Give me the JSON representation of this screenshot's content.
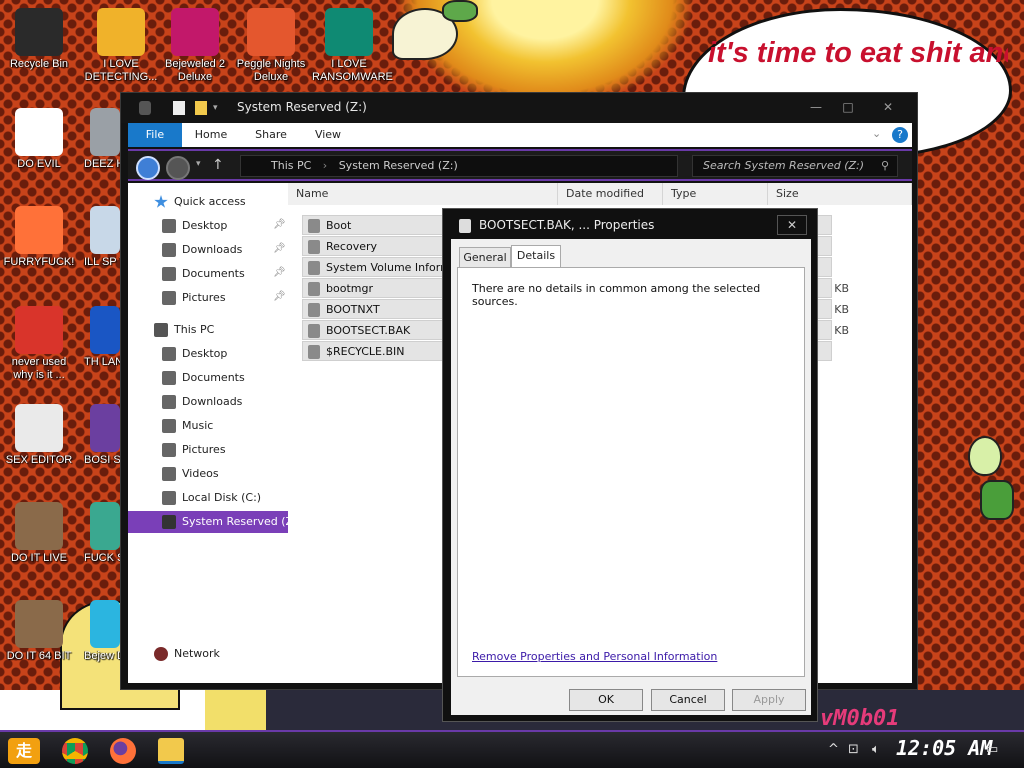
{
  "wallpaper": {
    "bubble_text": "it's time to eat shit and die and chew",
    "sign_text": "vM0b01"
  },
  "desktop_icons": [
    {
      "label": "Recycle Bin",
      "icon": "recycle-bin-icon",
      "color": "#2a2a2a"
    },
    {
      "label": "I LOVE DETECTING...",
      "icon": "detect-it-easy-icon",
      "color": "#f0b22a"
    },
    {
      "label": "Bejeweled 2 Deluxe",
      "icon": "bejeweled-icon",
      "color": "#c2186a"
    },
    {
      "label": "Peggle Nights Deluxe",
      "icon": "peggle-icon",
      "color": "#e4572e"
    },
    {
      "label": "I LOVE RANSOMWARE",
      "icon": "publisher-icon",
      "color": "#0f8a73"
    },
    {
      "label": "DO EVIL",
      "icon": "chrome-icon",
      "color": "#ffffff"
    },
    {
      "label": "DEEZ HAH G",
      "icon": "computer-icon",
      "color": "#9aa0a6"
    },
    {
      "label": "FURRYFUCK!",
      "icon": "firefox-icon",
      "color": "#ff7139"
    },
    {
      "label": "ILL SP YO",
      "icon": "spray-icon",
      "color": "#c8d8e8"
    },
    {
      "label": "never used why is it ...",
      "icon": "devcpp-icon",
      "color": "#d9342b"
    },
    {
      "label": "TH LANGUA",
      "icon": "go-icon",
      "color": "#1a56c4"
    },
    {
      "label": "SEX EDITOR",
      "icon": "hxd-icon",
      "color": "#eaeaea"
    },
    {
      "label": "BOSI SIMUL",
      "icon": "bonzi-icon",
      "color": "#6b3fa0"
    },
    {
      "label": "DO IT LIVE",
      "icon": "portrait-icon",
      "color": "#8a6a4a"
    },
    {
      "label": "FUCK S ELV",
      "icon": "game-icon",
      "color": "#3aa890"
    },
    {
      "label": "DO IT 64 BIT",
      "icon": "portrait-64-icon",
      "color": "#8a6a4a"
    },
    {
      "label": "Bejew Del",
      "icon": "gem-icon",
      "color": "#2bb5e0"
    }
  ],
  "explorer": {
    "title": "System Reserved (Z:)",
    "ribbon_tabs": [
      "File",
      "Home",
      "Share",
      "View"
    ],
    "address": {
      "crumbs": [
        "This PC",
        "System Reserved (Z:)"
      ]
    },
    "search_placeholder": "Search System Reserved (Z:)",
    "nav": {
      "quick_access": "Quick access",
      "quick_items": [
        "Desktop",
        "Downloads",
        "Documents",
        "Pictures"
      ],
      "this_pc": "This PC",
      "pc_items": [
        "Desktop",
        "Documents",
        "Downloads",
        "Music",
        "Pictures",
        "Videos",
        "Local Disk (C:)",
        "System Reserved (Z:)"
      ],
      "network": "Network"
    },
    "columns": [
      "Name",
      "Date modified",
      "Type",
      "Size"
    ],
    "files": [
      {
        "name": "Boot",
        "size": ""
      },
      {
        "name": "Recovery",
        "size": ""
      },
      {
        "name": "System Volume Informatio",
        "size": ""
      },
      {
        "name": "bootmgr",
        "size": "KB"
      },
      {
        "name": "BOOTNXT",
        "size": "KB"
      },
      {
        "name": "BOOTSECT.BAK",
        "size": "KB"
      },
      {
        "name": "$RECYCLE.BIN",
        "size": ""
      }
    ]
  },
  "properties": {
    "title": "BOOTSECT.BAK, ... Properties",
    "tabs": [
      "General",
      "Details"
    ],
    "active_tab": "Details",
    "message": "There are no details in common among the selected sources.",
    "link": "Remove Properties and Personal Information",
    "buttons": {
      "ok": "OK",
      "cancel": "Cancel",
      "apply": "Apply"
    }
  },
  "taskbar": {
    "clock": "12:05 AM",
    "apps": [
      "chrome-icon",
      "firefox-icon",
      "file-explorer-icon"
    ]
  },
  "colors": {
    "accent_purple": "#7a3fb8",
    "ribbon_file": "#1979ca",
    "link": "#3b1aa8"
  }
}
